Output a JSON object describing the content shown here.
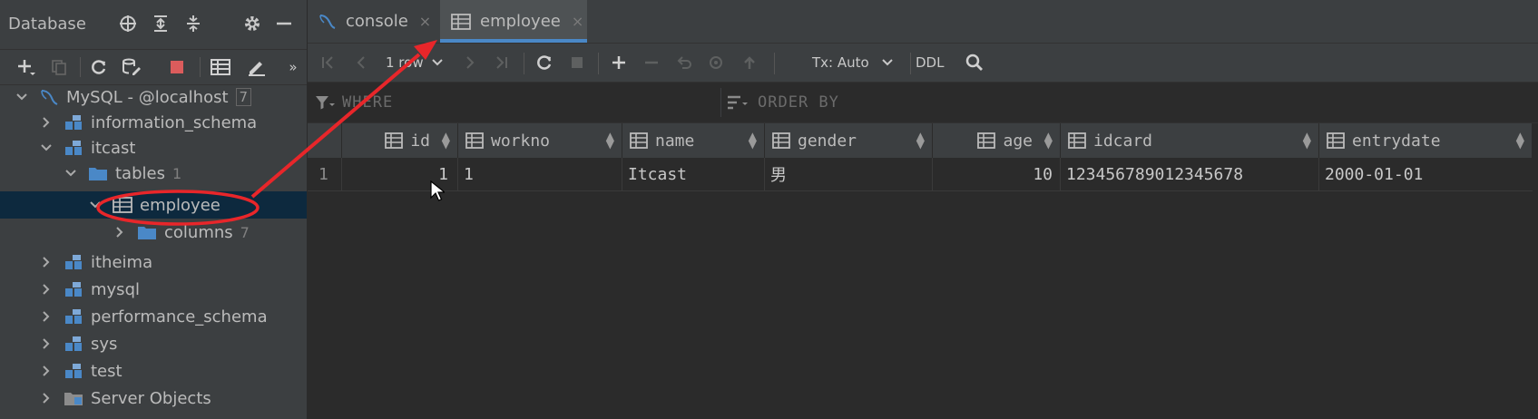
{
  "left_panel": {
    "title": "Database",
    "tree": [
      {
        "label": "MySQL - @localhost",
        "count": "7"
      },
      {
        "label": "information_schema"
      },
      {
        "label": "itcast"
      },
      {
        "label": "tables",
        "count": "1"
      },
      {
        "label": "employee"
      },
      {
        "label": "columns",
        "count": "7"
      },
      {
        "label": "itheima"
      },
      {
        "label": "mysql"
      },
      {
        "label": "performance_schema"
      },
      {
        "label": "sys"
      },
      {
        "label": "test"
      },
      {
        "label": "Server Objects"
      }
    ]
  },
  "tabs": [
    {
      "label": "console",
      "close": "×"
    },
    {
      "label": "employee",
      "close": "×"
    }
  ],
  "grid_toolbar": {
    "rows_label": "1 row",
    "tx_label": "Tx: Auto",
    "ddl_label": "DDL"
  },
  "filter": {
    "where": "WHERE",
    "order_by": "ORDER BY"
  },
  "table": {
    "columns": [
      "id",
      "workno",
      "name",
      "gender",
      "age",
      "idcard",
      "entrydate"
    ],
    "rows": [
      {
        "num": "1",
        "cells": [
          "1",
          "1",
          "Itcast",
          "男",
          "10",
          "123456789012345678",
          "2000-01-01"
        ]
      }
    ]
  },
  "colors": {
    "accent": "#4a88c7",
    "annotation": "#e8262a",
    "selection": "#0d293e"
  }
}
